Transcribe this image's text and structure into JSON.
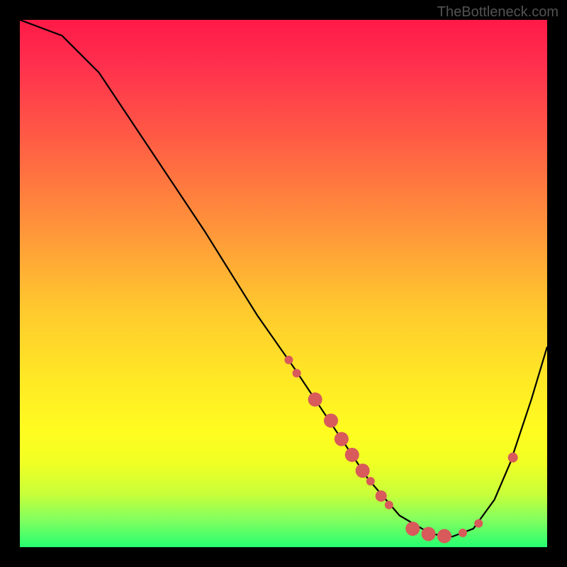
{
  "watermark": "TheBottleneck.com",
  "chart_data": {
    "type": "line",
    "title": "",
    "xlabel": "",
    "ylabel": "",
    "xlim": [
      0,
      100
    ],
    "ylim": [
      0,
      100
    ],
    "curve": {
      "name": "bottleneck-curve",
      "points": [
        {
          "x": 0,
          "y": 100
        },
        {
          "x": 8,
          "y": 97
        },
        {
          "x": 15,
          "y": 90
        },
        {
          "x": 25,
          "y": 75
        },
        {
          "x": 35,
          "y": 60
        },
        {
          "x": 45,
          "y": 44
        },
        {
          "x": 52,
          "y": 34
        },
        {
          "x": 60,
          "y": 22
        },
        {
          "x": 66,
          "y": 13
        },
        {
          "x": 72,
          "y": 6
        },
        {
          "x": 78,
          "y": 2.5
        },
        {
          "x": 82,
          "y": 2
        },
        {
          "x": 86,
          "y": 3.5
        },
        {
          "x": 90,
          "y": 9
        },
        {
          "x": 93,
          "y": 16
        },
        {
          "x": 97,
          "y": 28
        },
        {
          "x": 100,
          "y": 38
        }
      ]
    },
    "dots": {
      "name": "data-points",
      "color": "#d85a5a",
      "points": [
        {
          "x": 51,
          "y": 35.5,
          "r": 6
        },
        {
          "x": 52.5,
          "y": 33,
          "r": 6
        },
        {
          "x": 56,
          "y": 28,
          "r": 10
        },
        {
          "x": 59,
          "y": 24,
          "r": 10
        },
        {
          "x": 61,
          "y": 20.5,
          "r": 10
        },
        {
          "x": 63,
          "y": 17.5,
          "r": 10
        },
        {
          "x": 65,
          "y": 14.5,
          "r": 10
        },
        {
          "x": 66.5,
          "y": 12.5,
          "r": 6
        },
        {
          "x": 68.5,
          "y": 9.7,
          "r": 8
        },
        {
          "x": 70,
          "y": 8,
          "r": 6
        },
        {
          "x": 74.5,
          "y": 3.5,
          "r": 10
        },
        {
          "x": 77.5,
          "y": 2.5,
          "r": 10
        },
        {
          "x": 80.5,
          "y": 2.1,
          "r": 10
        },
        {
          "x": 84,
          "y": 2.7,
          "r": 6
        },
        {
          "x": 87,
          "y": 4.5,
          "r": 6
        },
        {
          "x": 93.5,
          "y": 17,
          "r": 7
        }
      ]
    }
  }
}
